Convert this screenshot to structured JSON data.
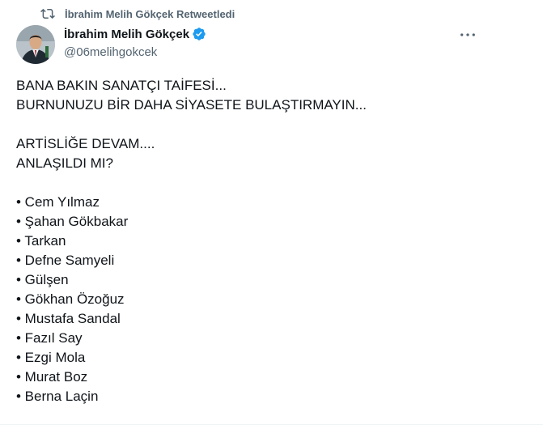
{
  "retweet": {
    "label": "İbrahim Melih Gökçek Retweetledi"
  },
  "author": {
    "name": "İbrahim Melih Gökçek",
    "handle": "@06melihgokcek",
    "verified": true
  },
  "tweet": {
    "paragraphs": [
      [
        "BANA BAKIN SANATÇI TAİFESİ...",
        "BURNUNUZU BİR DAHA SİYASETE BULAŞTIRMAYIN..."
      ],
      [
        "ARTİSLİĞE DEVAM....",
        "ANLAŞILDI MI?"
      ]
    ],
    "list": [
      "• Cem Yılmaz",
      "• Şahan Gökbakar",
      "• Tarkan",
      "• Defne Samyeli",
      "• Gülşen",
      "• Gökhan Özoğuz",
      "• Mustafa Sandal",
      "• Fazıl Say",
      "• Ezgi Mola",
      "• Murat Boz",
      "• Berna Laçin"
    ]
  },
  "colors": {
    "text": "#0f1419",
    "secondary": "#536471",
    "verified_blue": "#1d9bf0"
  },
  "icons": {
    "retweet": "retweet-icon",
    "verified": "verified-badge-icon",
    "more": "more-options-icon"
  }
}
